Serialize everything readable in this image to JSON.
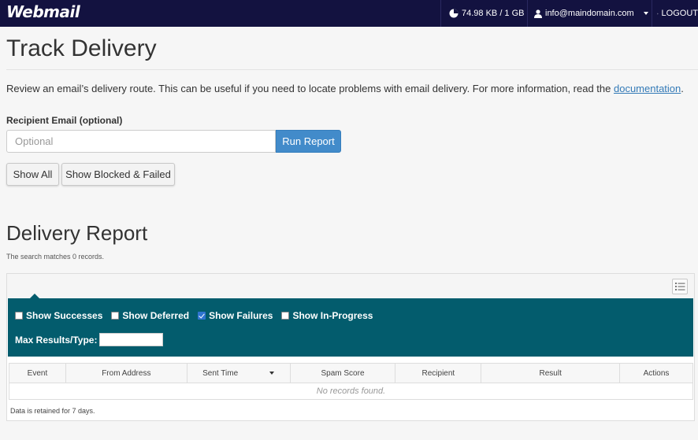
{
  "topbar": {
    "logo": "Webmail",
    "usage": "74.98 KB / 1 GB",
    "user": "info@maindomain.com",
    "logout": "LOGOUT"
  },
  "page": {
    "title": "Track Delivery",
    "intro": "Review an email’s delivery route. This can be useful if you need to locate problems with email delivery. For more information, read the ",
    "doc_link": "documentation",
    "intro_end": "."
  },
  "form": {
    "label": "Recipient Email (optional)",
    "placeholder": "Optional",
    "run_button": "Run Report",
    "show_all": "Show All",
    "show_blocked": "Show Blocked & Failed"
  },
  "report": {
    "title": "Delivery Report",
    "matches": "The search matches 0 records.",
    "filters": [
      {
        "label": "Show Successes",
        "checked": false
      },
      {
        "label": "Show Deferred",
        "checked": false
      },
      {
        "label": "Show Failures",
        "checked": true
      },
      {
        "label": "Show In-Progress",
        "checked": false
      }
    ],
    "max_label": "Max Results/Type:",
    "max_value": "",
    "columns": [
      "Event",
      "From Address",
      "Sent Time",
      "Spam Score",
      "Recipient",
      "Result",
      "Actions"
    ],
    "empty": "No records found.",
    "retained": "Data is retained for 7 days."
  }
}
